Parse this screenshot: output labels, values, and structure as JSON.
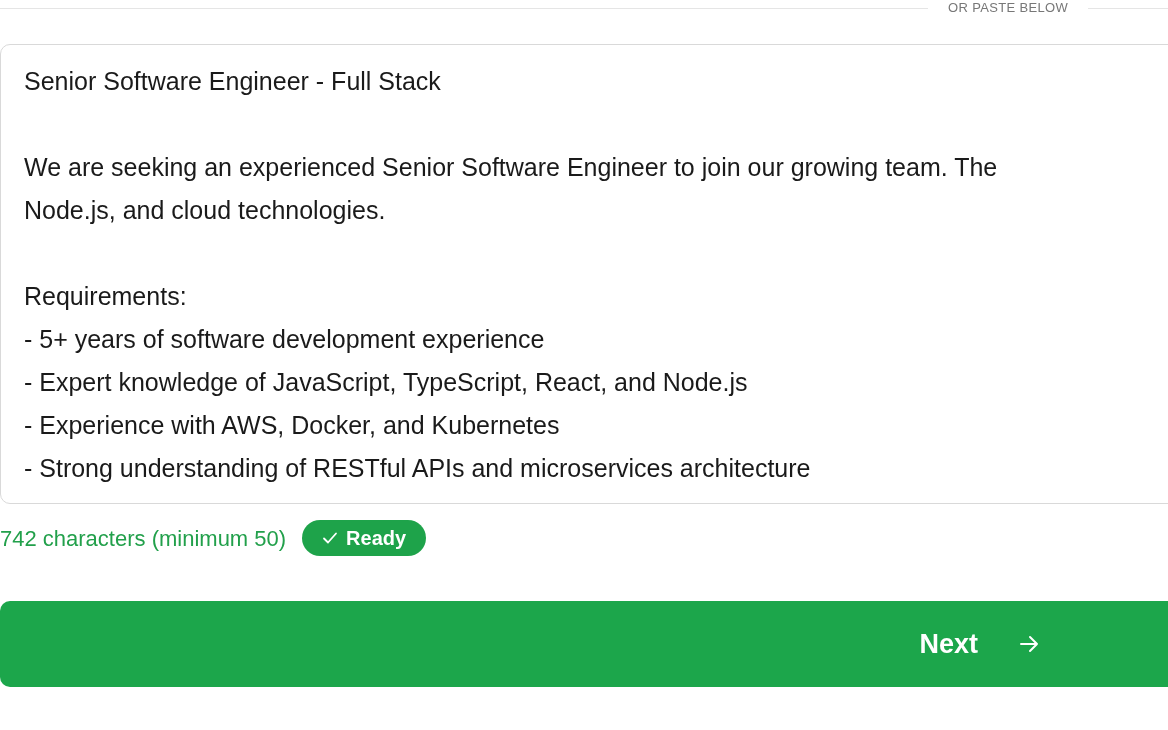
{
  "divider": {
    "label": "OR PASTE BELOW"
  },
  "job_description": {
    "paragraphs": [
      [
        "Senior Software Engineer - Full Stack"
      ],
      [
        "We are seeking an experienced Senior Software Engineer to join our growing team. The",
        "Node.js, and cloud technologies."
      ],
      [
        "Requirements:",
        "- 5+ years of software development experience",
        "- Expert knowledge of JavaScript, TypeScript, React, and Node.js",
        "- Experience with AWS, Docker, and Kubernetes",
        "- Strong understanding of RESTful APIs and microservices architecture"
      ]
    ]
  },
  "character_count": "742 characters (minimum 50)",
  "status_badge": {
    "label": "Ready",
    "ready": true
  },
  "next_button": {
    "label": "Next",
    "disabled": false
  }
}
